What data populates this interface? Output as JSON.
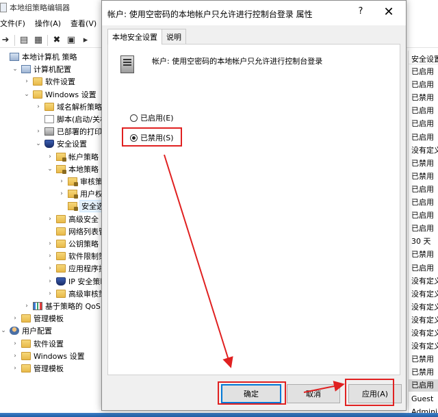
{
  "background_window": {
    "title": "本地组策略编辑器",
    "menu": [
      "文件(F)",
      "操作(A)",
      "查看(V)"
    ],
    "tree": [
      {
        "label": "本地计算机 策略",
        "indent": 0,
        "chev": "",
        "icon": "computer-icon"
      },
      {
        "label": "计算机配置",
        "indent": 1,
        "chev": "⌄",
        "icon": "computer-icon"
      },
      {
        "label": "软件设置",
        "indent": 2,
        "chev": "›",
        "icon": "folder-icon"
      },
      {
        "label": "Windows 设置",
        "indent": 2,
        "chev": "⌄",
        "icon": "folder-icon"
      },
      {
        "label": "域名解析策略",
        "indent": 3,
        "chev": "›",
        "icon": "folder-icon"
      },
      {
        "label": "脚本(启动/关机)",
        "indent": 3,
        "chev": "",
        "icon": "script-icon"
      },
      {
        "label": "已部署的打印机",
        "indent": 3,
        "chev": "›",
        "icon": "printer-icon"
      },
      {
        "label": "安全设置",
        "indent": 3,
        "chev": "⌄",
        "icon": "shield-icon"
      },
      {
        "label": "帐户策略",
        "indent": 4,
        "chev": "›",
        "icon": "folder-lock-icon"
      },
      {
        "label": "本地策略",
        "indent": 4,
        "chev": "⌄",
        "icon": "folder-lock-icon"
      },
      {
        "label": "审核策略",
        "indent": 5,
        "chev": "›",
        "icon": "folder-lock-icon"
      },
      {
        "label": "用户权限分",
        "indent": 5,
        "chev": "›",
        "icon": "folder-lock-icon"
      },
      {
        "label": "安全选项",
        "indent": 5,
        "chev": "",
        "icon": "folder-lock-icon",
        "selected": true
      },
      {
        "label": "高级安全 Win",
        "indent": 4,
        "chev": "›",
        "icon": "folder-icon"
      },
      {
        "label": "网络列表管理器",
        "indent": 4,
        "chev": "",
        "icon": "folder-icon"
      },
      {
        "label": "公钥策略",
        "indent": 4,
        "chev": "›",
        "icon": "folder-icon"
      },
      {
        "label": "软件限制策略",
        "indent": 4,
        "chev": "›",
        "icon": "folder-icon"
      },
      {
        "label": "应用程序控制策",
        "indent": 4,
        "chev": "›",
        "icon": "folder-icon"
      },
      {
        "label": "IP 安全策略，",
        "indent": 4,
        "chev": "›",
        "icon": "shield-icon"
      },
      {
        "label": "高级审核策略配",
        "indent": 4,
        "chev": "›",
        "icon": "folder-icon"
      },
      {
        "label": "基于策略的 QoS",
        "indent": 2,
        "chev": "›",
        "icon": "chart-icon"
      },
      {
        "label": "管理模板",
        "indent": 1,
        "chev": "›",
        "icon": "folder-icon"
      },
      {
        "label": "用户配置",
        "indent": 0,
        "chev": "⌄",
        "icon": "user-icon"
      },
      {
        "label": "软件设置",
        "indent": 1,
        "chev": "›",
        "icon": "folder-icon"
      },
      {
        "label": "Windows 设置",
        "indent": 1,
        "chev": "›",
        "icon": "folder-icon"
      },
      {
        "label": "管理模板",
        "indent": 1,
        "chev": "›",
        "icon": "folder-icon"
      }
    ],
    "right_column_header": "安全设置",
    "right_column_values": [
      "已启用",
      "已启用",
      "已禁用",
      "已启用",
      "已启用",
      "已启用",
      "没有定义",
      "已禁用",
      "已禁用",
      "已启用",
      "已启用",
      "已启用",
      "已启用",
      "30 天",
      "已禁用",
      "已启用",
      "没有定义",
      "没有定义",
      "没有定义",
      "没有定义",
      "没有定义",
      "没有定义",
      "已禁用",
      "已禁用",
      "已启用",
      "Guest",
      "Administ",
      "没有定义"
    ],
    "right_column_selected_index": 24
  },
  "dialog": {
    "title": "帐户: 使用空密码的本地帐户只允许进行控制台登录 属性",
    "help": "?",
    "close": "✕",
    "tabs": [
      {
        "label": "本地安全设置",
        "active": true
      },
      {
        "label": "说明",
        "active": false
      }
    ],
    "policy_name": "帐户: 使用空密码的本地帐户只允许进行控制台登录",
    "options": [
      {
        "label": "已启用(E)",
        "checked": false
      },
      {
        "label": "已禁用(S)",
        "checked": true
      }
    ],
    "buttons": {
      "ok": "确定",
      "cancel": "取消",
      "apply": "应用(A)"
    }
  },
  "annotation_color": "#e02020"
}
